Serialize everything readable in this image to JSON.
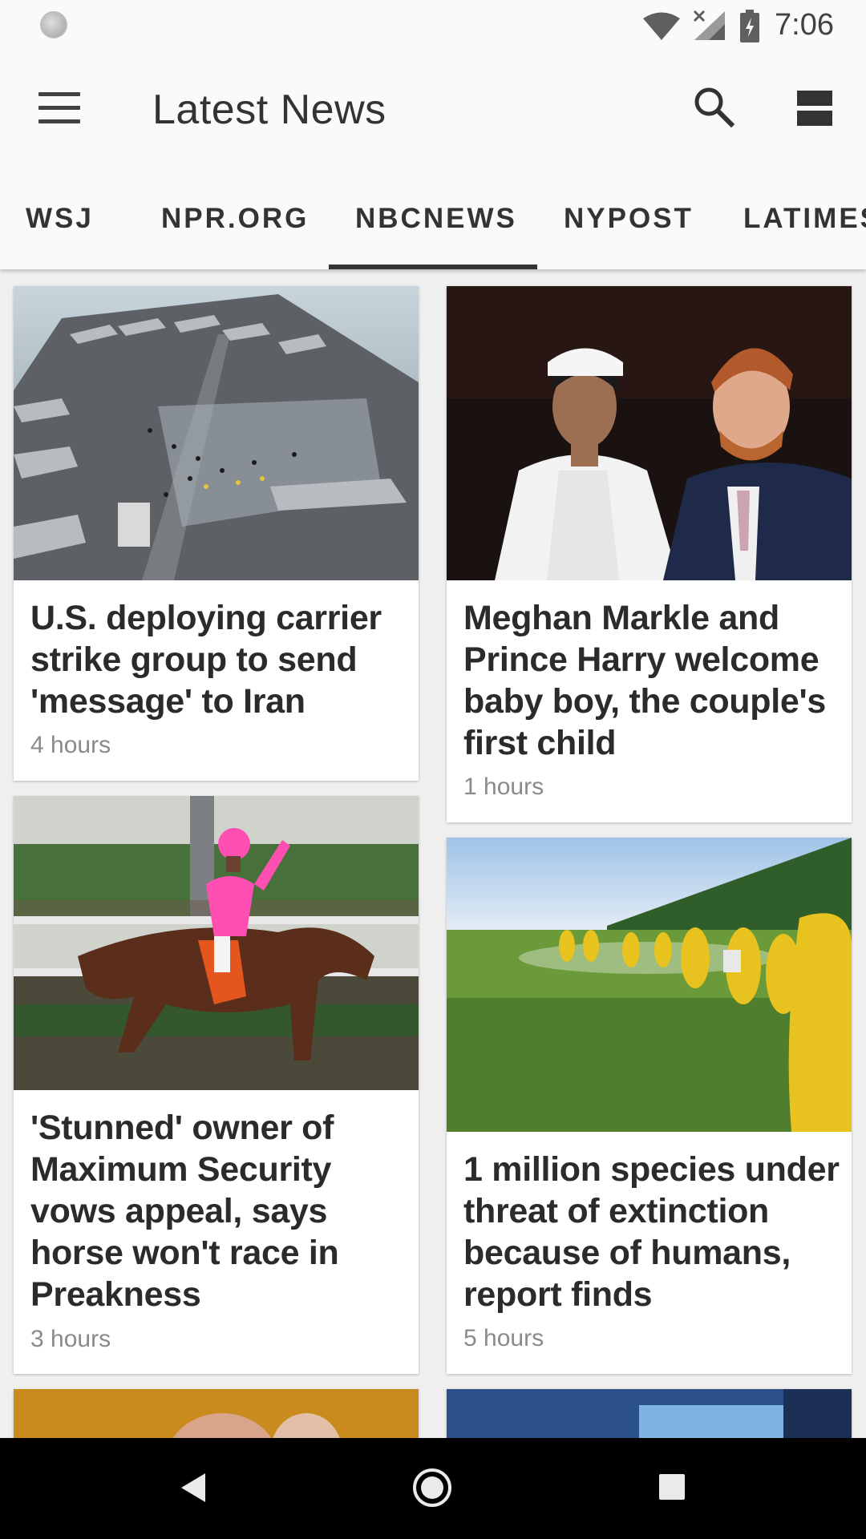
{
  "status_bar": {
    "time": "7:06"
  },
  "app_bar": {
    "title": "Latest News",
    "icons": [
      "menu-icon",
      "search-icon",
      "view-toggle-icon"
    ]
  },
  "tabs": [
    {
      "label": "WSJ",
      "selected": false
    },
    {
      "label": "NPR.ORG",
      "selected": false
    },
    {
      "label": "NBCNEWS",
      "selected": true
    },
    {
      "label": "NYPOST",
      "selected": false
    },
    {
      "label": "LATIMES",
      "selected": false
    }
  ],
  "articles": [
    {
      "title": "U.S. deploying carrier strike group to send 'message' to Iran",
      "time": "4 hours",
      "image": "aircraft carrier deck with fighter jets"
    },
    {
      "title": "Meghan Markle and Prince Harry welcome baby boy, the couple's first child",
      "time": "1 hours",
      "image": "Meghan Markle and Prince Harry"
    },
    {
      "title": "'Stunned' owner of Maximum Security vows appeal, says horse won't race in Preakness",
      "time": "3 hours",
      "image": "jockey in pink riding racehorse"
    },
    {
      "title": "1 million species under threat of extinction because of humans, report finds",
      "time": "5 hours",
      "image": "workers in yellow suits spraying a green field"
    }
  ],
  "nav_bar": {
    "icons": [
      "back-icon",
      "home-icon",
      "recents-icon"
    ]
  }
}
